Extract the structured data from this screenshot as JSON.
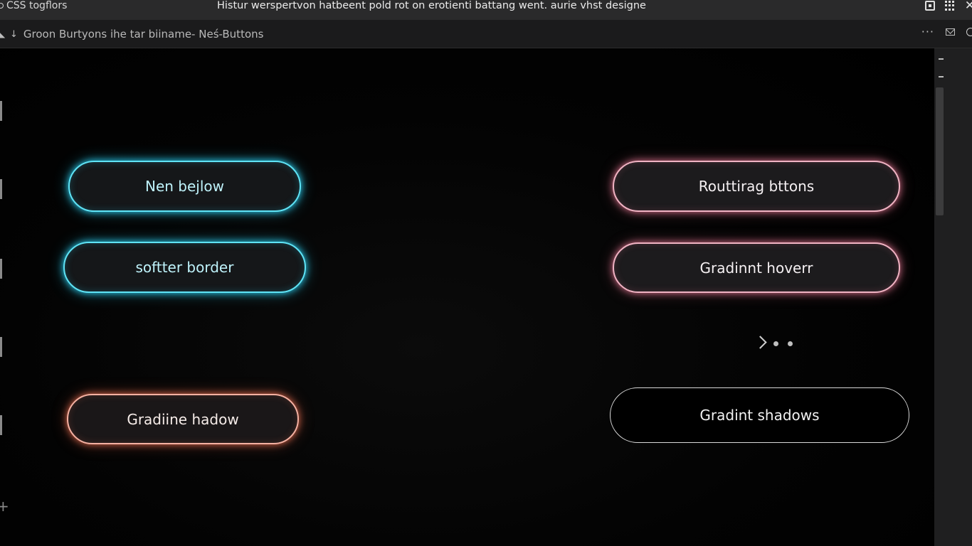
{
  "window": {
    "app_name": "CSS togflors",
    "title": "Histur werspertvon hatbeent pold rot on erotienti battang went. aurie vhst designe"
  },
  "tabbar": {
    "breadcrumb": "Groon Burtyons ihe tar  biiname-  Neś-Buttons"
  },
  "buttons": {
    "neon_below": "Nen bejlow",
    "softer_border": "softter border",
    "gradline_shadow": "Gradiine hadow",
    "routing_buttons": "Routtirag bttons",
    "gradient_hover": "Gradinnt hoverr",
    "gradient_shadows": "Gradint shadows"
  },
  "colors": {
    "cyan_glow": "#29c6e6",
    "pink_glow": "#eb7896",
    "coral_glow": "#ec6e50",
    "background": "#000000",
    "titlebar": "#2a2a2b"
  },
  "icons": {
    "window_controls": [
      "screen-capture-icon",
      "apps-grid-icon",
      "close-icon"
    ],
    "tab_tools": [
      "more-icon",
      "mail-icon",
      "search-icon"
    ],
    "carousel": [
      "chevron-right-icon",
      "dot-icon",
      "dot-icon"
    ]
  }
}
